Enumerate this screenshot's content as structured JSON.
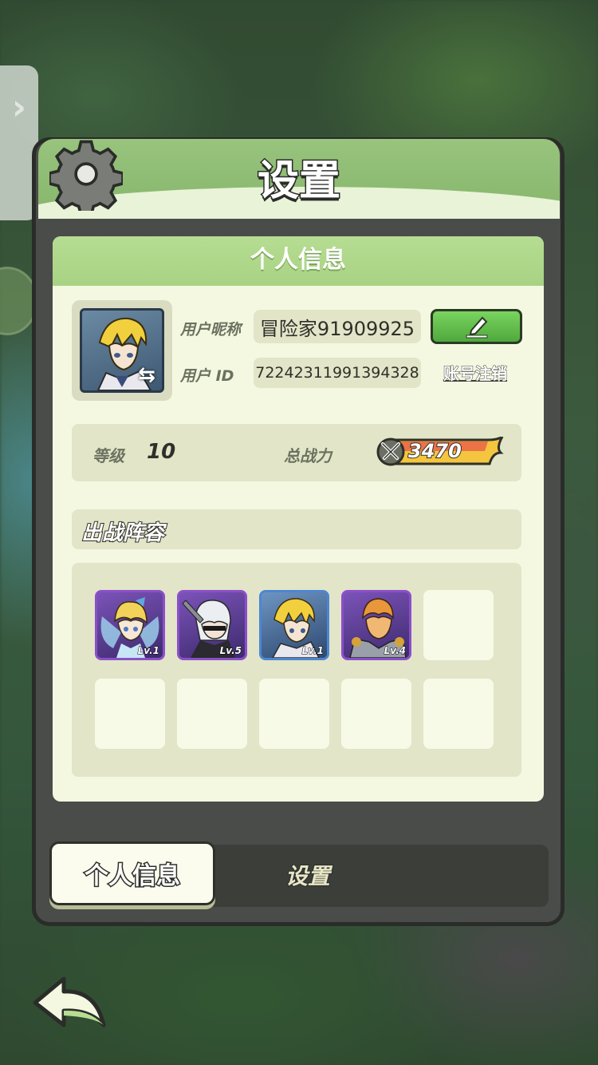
{
  "title": "设置",
  "card_header": "个人信息",
  "profile": {
    "nickname_label": "用户昵称",
    "nickname": "冒险家91909925",
    "id_label": "用户 ID",
    "id": "72242311991394328",
    "deregister_label": "账号注销"
  },
  "stats": {
    "level_label": "等级",
    "level": "10",
    "power_label": "总战力",
    "power": "3470"
  },
  "lineup": {
    "title": "出战阵容",
    "heroes": [
      {
        "level": "Lv.1",
        "frame": "purple"
      },
      {
        "level": "Lv.5",
        "frame": "purple"
      },
      {
        "level": "Lv.1",
        "frame": "blue"
      },
      {
        "level": "Lv.4",
        "frame": "purple"
      }
    ]
  },
  "tabs": {
    "active": "个人信息",
    "inactive": "设置"
  },
  "icons": {
    "gear": "gear-icon",
    "edit": "pencil-icon",
    "back": "back-arrow-icon",
    "swap": "swap-icon",
    "power": "crossed-swords-icon",
    "side": "chevron-right-icon"
  },
  "colors": {
    "header_green": "#98c47d",
    "card_bg": "#f4f8e1",
    "edit_green": "#4fa83c",
    "power_yellow": "#f4c53f",
    "hero_frame_purple": "#8b4fc9",
    "hero_frame_blue": "#4c86d2"
  }
}
